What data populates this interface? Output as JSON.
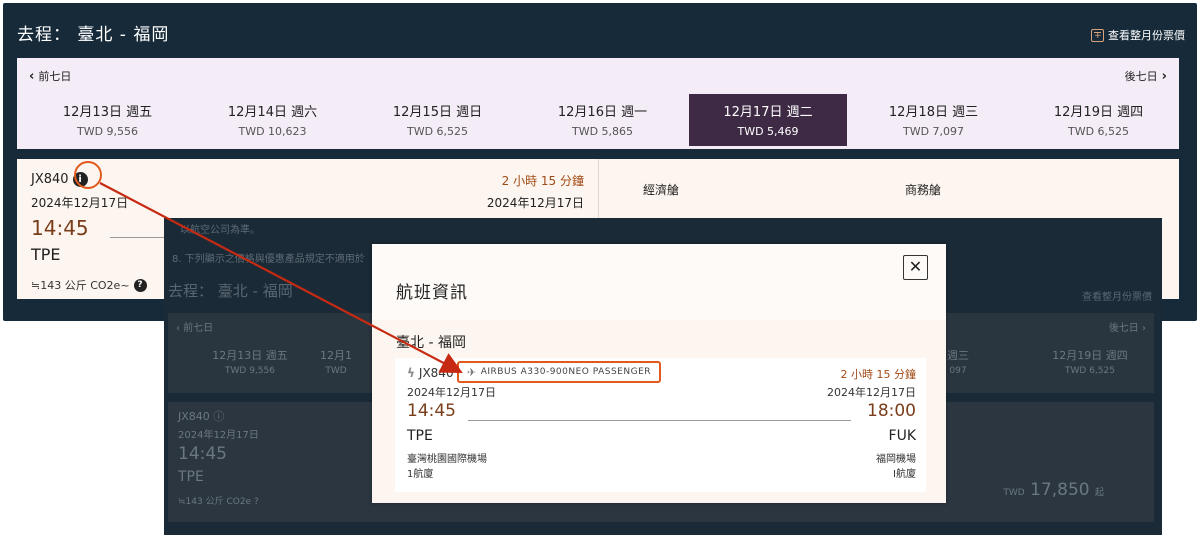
{
  "top": {
    "title": "去程： 臺北 - 福岡",
    "month_link": "查看整月份票價",
    "prev_label": "前七日",
    "next_label": "後七日",
    "days": [
      {
        "date": "12月13日 週五",
        "price": "TWD 9,556"
      },
      {
        "date": "12月14日 週六",
        "price": "TWD 10,623"
      },
      {
        "date": "12月15日 週日",
        "price": "TWD 6,525"
      },
      {
        "date": "12月16日 週一",
        "price": "TWD 5,865"
      },
      {
        "date": "12月17日 週二",
        "price": "TWD 5,469"
      },
      {
        "date": "12月18日 週三",
        "price": "TWD 7,097"
      },
      {
        "date": "12月19日 週四",
        "price": "TWD 6,525"
      }
    ],
    "selected_index": 4
  },
  "flight": {
    "number": "JX840",
    "date": "2024年12月17日",
    "duration": "2 小時 15 分鐘",
    "arrival_date": "2024年12月17日",
    "depart_time": "14:45",
    "depart_code": "TPE",
    "co2": "≒143 公斤 CO2e~",
    "cabin_economy": "經濟艙",
    "cabin_business": "商務艙"
  },
  "overlay": {
    "notice1": "以航空公司為準。",
    "notice2": "8. 下列顯示之價格與優惠產品規定不適用於",
    "title": "去程： 臺北 - 福岡",
    "month_link": "查看整月份票價",
    "prev_label": "前七日",
    "next_label": "後七日",
    "days": [
      {
        "date": "12月13日 週五",
        "price": "TWD 9,556"
      },
      {
        "date": "12月1",
        "price": "TWD"
      },
      {
        "date": "週三",
        "price": "097"
      },
      {
        "date": "12月19日 週四",
        "price": "TWD 6,525"
      }
    ],
    "flight_number": "JX840",
    "flight_date": "2024年12月17日",
    "flight_time": "14:45",
    "flight_code": "TPE",
    "flight_co2": "≒143 公斤 CO2e",
    "price_currency": "TWD",
    "price_amount": "17,850",
    "price_suffix": "起"
  },
  "modal": {
    "title": "航班資訊",
    "close": "✕",
    "route": "臺北 - 福岡",
    "flight_number": "JX840",
    "aircraft": "AIRBUS A330-900NEO PASSENGER",
    "duration": "2 小時 15 分鐘",
    "depart_date": "2024年12月17日",
    "arrive_date": "2024年12月17日",
    "depart_time": "14:45",
    "arrive_time": "18:00",
    "depart_code": "TPE",
    "arrive_code": "FUK",
    "depart_airport": "臺灣桃園國際機場",
    "arrive_airport": "福岡機場",
    "depart_terminal": "1航廈",
    "arrive_terminal": "I航廈"
  },
  "colors": {
    "navy": "#172a39",
    "accent": "#e05a1e",
    "selected_day": "#3e2a45",
    "duration_text": "#a04b16"
  }
}
